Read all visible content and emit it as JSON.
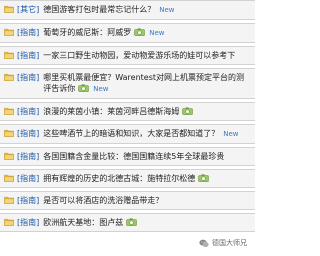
{
  "rows": [
    {
      "tag": "[其它]",
      "title": "德国游客打包时最常忘记什么？",
      "camera": false,
      "new": true
    },
    {
      "tag": "[指南]",
      "title": "葡萄牙的威尼斯：阿威罗",
      "camera": true,
      "new": true
    },
    {
      "tag": "[指南]",
      "title": "一家三口野生动物园，爱动物爱游乐场的娃可以参考下",
      "camera": false,
      "new": false
    },
    {
      "tag": "[指南]",
      "title": "哪里买机票最便宜？Warentest对网上机票预定平台的测评告诉你",
      "camera": true,
      "new": true
    },
    {
      "tag": "[指南]",
      "title": "浪漫的莱茵小镇：莱茵河畔吕德斯海姆",
      "camera": true,
      "new": false
    },
    {
      "tag": "[指南]",
      "title": "这些啤酒节上的暗语和知识，大家是否都知道了？",
      "camera": false,
      "new": true
    },
    {
      "tag": "[指南]",
      "title": "各国国籍含金量比较：德国国籍连续5年全球最珍贵",
      "camera": false,
      "new": false
    },
    {
      "tag": "[指南]",
      "title": "拥有辉煌的历史的北德古城：施特拉尔松德",
      "camera": true,
      "new": false
    },
    {
      "tag": "[指南]",
      "title": "是否可以将酒店的洗浴赠品带走？",
      "camera": false,
      "new": false
    },
    {
      "tag": "[指南]",
      "title": "欧洲航天基地：图卢兹",
      "camera": true,
      "new": false
    }
  ],
  "new_label": "New",
  "watermark": {
    "text": "德国大师兄",
    "icon": "wechat-icon"
  },
  "colors": {
    "row_bg": "#f4f4f4",
    "row_border": "#d2d2d2",
    "tag": "#1a57a8",
    "new": "#3a78c9",
    "folder": "#e8c45a"
  }
}
